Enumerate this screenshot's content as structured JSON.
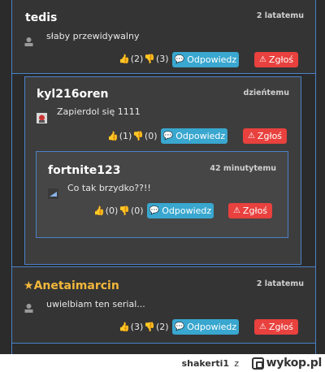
{
  "comments": [
    {
      "author": "tedis",
      "time": "2 latatemu",
      "text": "słaby przewidywalny",
      "upvotes": "(2)",
      "downvotes": "(3)",
      "reply_label": "Odpowiedz",
      "report_label": "Zgłoś"
    },
    {
      "author": "kyl216oren",
      "time": "dzieńtemu",
      "text": "Zapierdol się 1111",
      "upvotes": "(1)",
      "downvotes": "(0)",
      "reply_label": "Odpowiedz",
      "report_label": "Zgłoś"
    },
    {
      "author": "fortnite123",
      "time": "42 minutytemu",
      "text": "Co tak brzydko??!!",
      "upvotes": "(0)",
      "downvotes": "(0)",
      "reply_label": "Odpowiedz",
      "report_label": "Zgłoś"
    },
    {
      "author": "Anetaimarcin",
      "time": "2 latatemu",
      "text": "uwielbiam ten serial...",
      "upvotes": "(3)",
      "downvotes": "(2)",
      "reply_label": "Odpowiedz",
      "report_label": "Zgłoś"
    }
  ],
  "footer": {
    "username": "shakerti1",
    "via": "z",
    "brand": "wykop.pl"
  },
  "colors": {
    "accent_border": "#4a82c8",
    "reply": "#39a7cf",
    "report": "#e8413e",
    "upvote": "#5cc641",
    "downvote": "#e03b3b",
    "featured_author": "#f2b73b"
  }
}
